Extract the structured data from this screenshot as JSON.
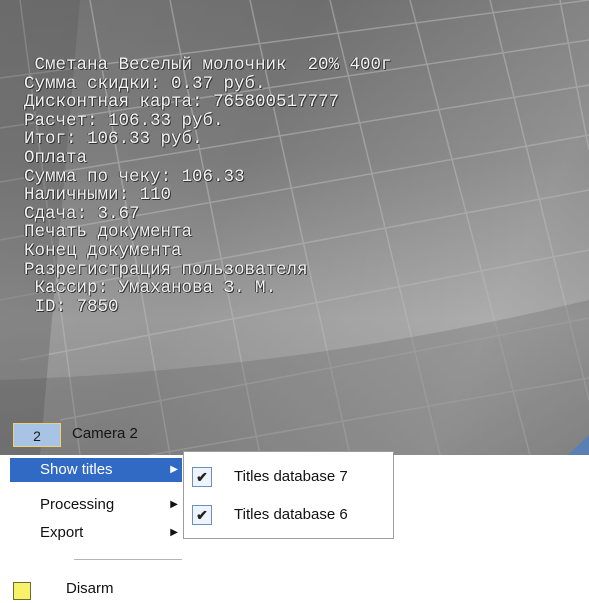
{
  "camera": {
    "number": "2",
    "name": "Camera 2",
    "ticker_lines": [
      " Сметана Веселый молочник  20% 400г",
      "Сумма скидки: 0.37 руб.",
      "Дисконтная карта: 765800517777",
      "Расчет: 106.33 руб.",
      "Итог: 106.33 руб.",
      "Оплата",
      "Сумма по чеку: 106.33",
      "Наличными: 110",
      "Сдача: 3.67",
      "Печать документа",
      "Конец документа",
      "Разрегистрация пользователя",
      " Кассир: Умаханова З. М.",
      " ID: 7850"
    ]
  },
  "context_menu": {
    "items": [
      {
        "label": "Show titles",
        "has_submenu": true,
        "active": true
      },
      {
        "label": "Processing",
        "has_submenu": true,
        "active": false
      },
      {
        "label": "Export",
        "has_submenu": true,
        "active": false
      }
    ],
    "disarm_label": "Disarm"
  },
  "submenu": {
    "items": [
      {
        "label": "Titles database 7",
        "checked": true
      },
      {
        "label": "Titles database 6",
        "checked": true
      }
    ]
  },
  "colors": {
    "menu_highlight": "#316ac5",
    "camera_number_bg": "#a9c3e5",
    "disarm_icon": "#f8f16a"
  },
  "icons": {
    "submenu_arrow": "triangle-right-icon",
    "check": "checkmark-icon",
    "disarm": "yellow-square-icon"
  }
}
